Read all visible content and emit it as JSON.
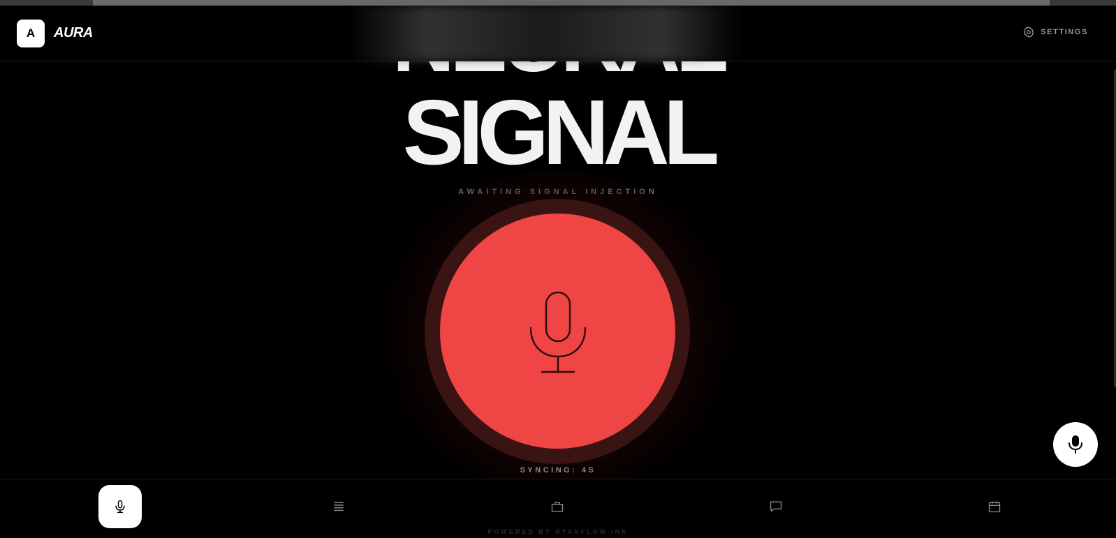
{
  "header": {
    "logo_letter": "A",
    "brand": "AURA",
    "settings_label": "SETTINGS"
  },
  "hero": {
    "title_partial": "NEURAL",
    "title": "SIGNAL",
    "status": "AWAITING SIGNAL INJECTION",
    "sync": "SYNCING: 4S"
  },
  "colors": {
    "accent": "#ef4545",
    "background": "#000000"
  },
  "nav": {
    "items": [
      {
        "icon": "mic-icon",
        "active": true
      },
      {
        "icon": "list-icon",
        "active": false
      },
      {
        "icon": "briefcase-icon",
        "active": false
      },
      {
        "icon": "chat-icon",
        "active": false
      },
      {
        "icon": "calendar-icon",
        "active": false
      }
    ]
  },
  "footer": {
    "powered": "POWERED BY RYANFLOW.INK"
  }
}
